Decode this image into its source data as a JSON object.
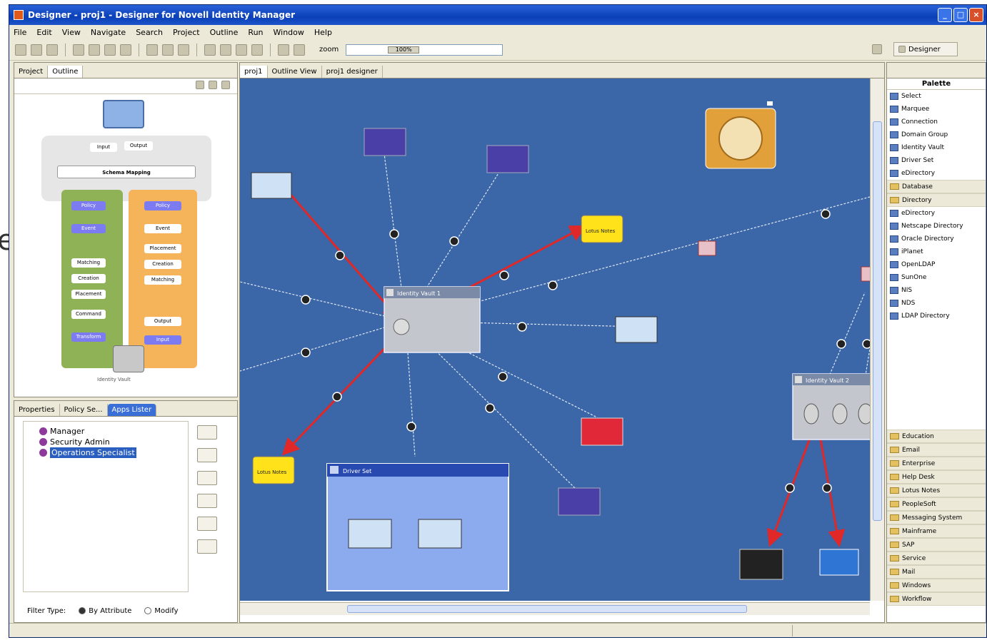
{
  "window": {
    "title": "Designer - proj1 - Designer for Novell Identity Manager"
  },
  "menu": [
    "File",
    "Edit",
    "View",
    "Navigate",
    "Search",
    "Project",
    "Outline",
    "Run",
    "Window",
    "Help"
  ],
  "toolbar": {
    "zoom_label": "zoom",
    "zoom_value": "100%"
  },
  "perspective": {
    "label": "Designer"
  },
  "outline_panel": {
    "tabs": [
      "Project",
      "Outline"
    ],
    "overview": {
      "vault_label": "Identity Vault",
      "chips": {
        "input": "Input",
        "output": "Output",
        "schema_mapping": "Schema Mapping",
        "policy": "Policy",
        "event": "Event",
        "matching": "Matching",
        "creation": "Creation",
        "placement": "Placement",
        "command": "Command",
        "transform": "Transform"
      }
    }
  },
  "apps_panel": {
    "tabs": [
      "Properties",
      "Policy Se...",
      "Apps Lister"
    ],
    "tree": [
      "Manager",
      "Security Admin",
      "Operations Specialist"
    ],
    "filter_label": "Filter Type:",
    "filter_options": [
      "By Attribute",
      "Modify"
    ]
  },
  "editor": {
    "tabs": [
      "proj1",
      "Outline View",
      "proj1 designer"
    ],
    "labels": {
      "vault1": "Identity Vault 1",
      "vault2": "Identity Vault 2",
      "driver_set": "Driver Set",
      "lotus_notes": "Lotus Notes"
    }
  },
  "palette": {
    "title": "Palette",
    "items": [
      {
        "label": "Select",
        "icon": "select-arrow-icon"
      },
      {
        "label": "Marquee",
        "icon": "marquee-icon"
      },
      {
        "label": "Connection",
        "icon": "connection-icon"
      },
      {
        "label": "Domain Group",
        "icon": "domain-group-icon"
      },
      {
        "label": "Identity Vault",
        "icon": "identity-vault-icon"
      },
      {
        "label": "Driver Set",
        "icon": "driver-set-icon"
      },
      {
        "label": "eDirectory",
        "icon": "edirectory-icon"
      }
    ],
    "drawers_top": [
      "Database",
      "Directory"
    ],
    "directory_items": [
      "eDirectory",
      "Netscape Directory",
      "Oracle Directory",
      "iPlanet",
      "OpenLDAP",
      "SunOne",
      "NIS",
      "NDS",
      "LDAP Directory"
    ],
    "drawers_bottom": [
      "Education",
      "Email",
      "Enterprise",
      "Help Desk",
      "Lotus Notes",
      "PeopleSoft",
      "Messaging System",
      "Mainframe",
      "SAP",
      "Service",
      "Mail",
      "Windows",
      "Workflow"
    ]
  },
  "colors": {
    "canvas": "#3b66a7",
    "link": "#e02828",
    "title_blue": "#0a3fb8"
  }
}
